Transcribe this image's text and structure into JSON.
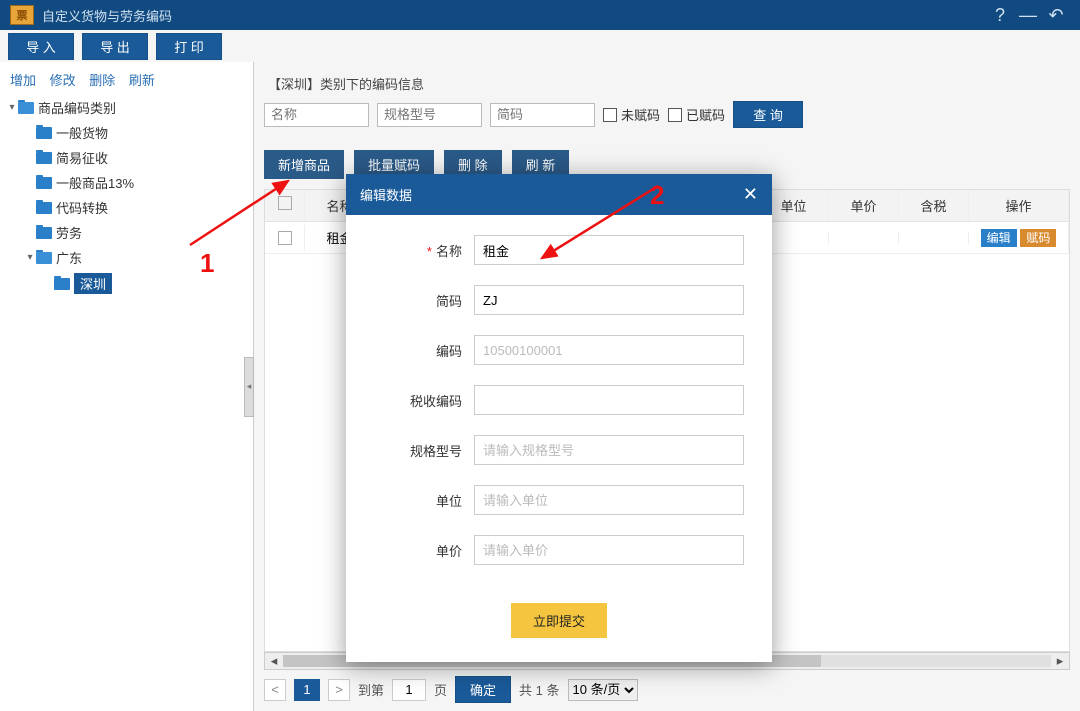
{
  "titlebar": {
    "logo_text": "票",
    "title": "自定义货物与劳务编码"
  },
  "toolbar": {
    "import": "导 入",
    "export": "导 出",
    "print": "打 印"
  },
  "sidebar": {
    "links": {
      "add": "增加",
      "modify": "修改",
      "delete": "删除",
      "refresh": "刷新"
    },
    "root": "商品编码类别",
    "items": [
      "一般货物",
      "简易征收",
      "一般商品13%",
      "代码转换",
      "劳务"
    ],
    "gd": "广东",
    "sz": "深圳"
  },
  "content": {
    "section_title": "【深圳】类别下的编码信息",
    "ph_name": "名称",
    "ph_spec": "规格型号",
    "ph_short": "简码",
    "chk_unassigned": "未赋码",
    "chk_assigned": "已赋码",
    "btn_query": "查 询",
    "btn_add": "新增商品",
    "btn_batch": "批量赋码",
    "btn_del": "删  除",
    "btn_refresh": "刷  新",
    "th": {
      "name": "名称",
      "unit": "单位",
      "price": "单价",
      "tax": "含税",
      "op": "操作"
    },
    "row": {
      "name": "租金",
      "edit": "编辑",
      "code": "赋码"
    }
  },
  "pager": {
    "goto": "到第",
    "page_unit": "页",
    "confirm": "确定",
    "total_prefix": "共",
    "total_count": "1",
    "total_suffix": "条",
    "page_value": "1",
    "per_page": "10 条/页"
  },
  "annotations": {
    "one": "1",
    "two": "2"
  },
  "modal": {
    "title": "编辑数据",
    "labels": {
      "name": "名称",
      "short": "简码",
      "code": "编码",
      "taxcode": "税收编码",
      "spec": "规格型号",
      "unit": "单位",
      "price": "单价"
    },
    "values": {
      "name": "租金",
      "short": "ZJ",
      "code": "10500100001"
    },
    "placeholders": {
      "spec": "请输入规格型号",
      "unit": "请输入单位",
      "price": "请输入单价"
    },
    "submit": "立即提交"
  }
}
